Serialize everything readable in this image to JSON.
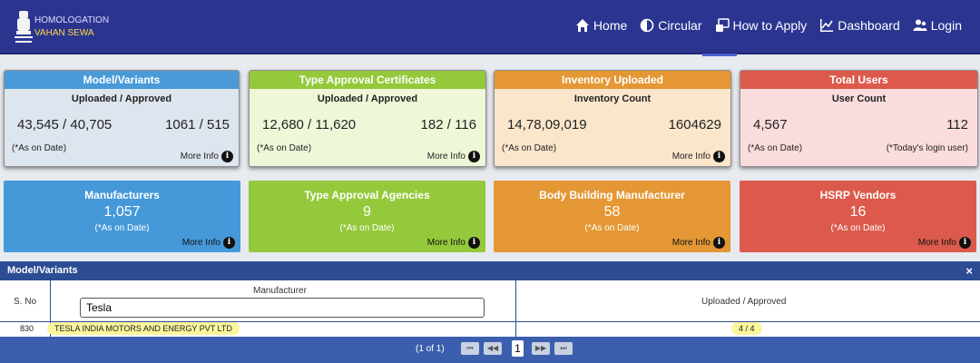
{
  "brand": {
    "line1": "HOMOLOGATION",
    "line2": "VAHAN SEWA"
  },
  "nav": [
    {
      "label": "Home",
      "icon": "home-icon"
    },
    {
      "label": "Circular",
      "icon": "circle-half-icon"
    },
    {
      "label": "How to Apply",
      "icon": "apply-icon"
    },
    {
      "label": "Dashboard",
      "icon": "chart-icon"
    },
    {
      "label": "Login",
      "icon": "users-icon"
    }
  ],
  "cards": [
    {
      "title": "Model/Variants",
      "subtitle": "Uploaded / Approved",
      "left": "43,545 / 40,705",
      "right": "1061 / 515",
      "note_left": "(*As on Date)",
      "note_right": "",
      "more": "More Info",
      "head_color": "#4a9ad8",
      "body_color": "#dde5ee"
    },
    {
      "title": "Type Approval Certificates",
      "subtitle": "Uploaded / Approved",
      "left": "12,680 / 11,620",
      "right": "182 / 116",
      "note_left": "(*As on Date)",
      "note_right": "",
      "more": "More Info",
      "head_color": "#94c93b",
      "body_color": "#eef8d8"
    },
    {
      "title": "Inventory Uploaded",
      "subtitle": "Inventory Count",
      "left": "14,78,09,019",
      "right": "1604629",
      "note_left": "(*As on Date)",
      "note_right": "",
      "more": "More Info",
      "head_color": "#e49734",
      "body_color": "#fbe6cc"
    },
    {
      "title": "Total Users",
      "subtitle": "User Count",
      "left": "4,567",
      "right": "112",
      "note_left": "(*As on Date)",
      "note_right": "(*Today's login user)",
      "more": "",
      "head_color": "#dc5a4c",
      "body_color": "#fbdcdc"
    }
  ],
  "cards2": [
    {
      "title": "Manufacturers",
      "value": "1,057",
      "note": "(*As on Date)",
      "more": "More Info",
      "color": "#4599d9"
    },
    {
      "title": "Type Approval Agencies",
      "value": "9",
      "note": "(*As on Date)",
      "more": "More Info",
      "color": "#94c93b"
    },
    {
      "title": "Body Building Manufacturer",
      "value": "58",
      "note": "(*As on Date)",
      "more": "More Info",
      "color": "#e49734"
    },
    {
      "title": "HSRP Vendors",
      "value": "16",
      "note": "(*As on Date)",
      "more": "More Info",
      "color": "#dc5a4c"
    }
  ],
  "panel": {
    "title": "Model/Variants",
    "close": "×",
    "col_sno": "S. No",
    "col_manufacturer": "Manufacturer",
    "col_uploaded": "Uploaded / Approved",
    "search_value": "Tesla",
    "rows": [
      {
        "sno": "830",
        "manufacturer": "TESLA INDIA MOTORS AND ENERGY PVT LTD",
        "count": "4 / 4"
      }
    ]
  },
  "pager": {
    "info": "(1 of 1)",
    "first": "⏮",
    "prev": "◀◀",
    "current": "1",
    "next": "▶▶",
    "last": "⏭"
  }
}
